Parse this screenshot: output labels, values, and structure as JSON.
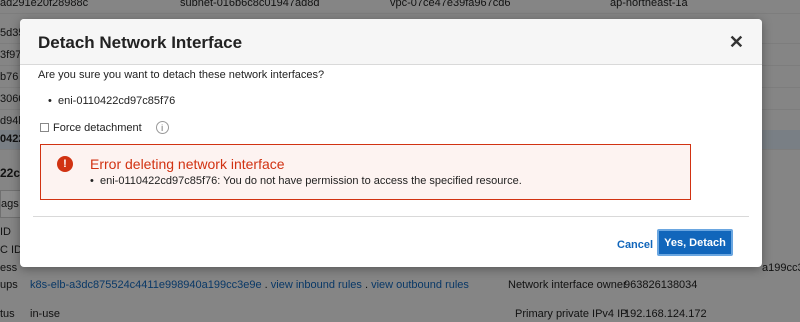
{
  "background": {
    "top_row": {
      "col1": "ad291e20f28988c",
      "col2": "subnet-016b6c8c01947ad8d",
      "col3": "vpc-07ce47e39fa967cd6",
      "col4": "ap-northeast-1a"
    },
    "left_fragments": [
      "5d35",
      "3f97",
      "b76",
      "3060",
      "d94b",
      "0422",
      "22c"
    ],
    "tab_label": "ags",
    "left_labels": [
      "ID",
      "C ID",
      "ess",
      "ups",
      "tus"
    ],
    "security_groups": {
      "group": "k8s-elb-a3dc875524c4411e998940a199cc3e9e",
      "inbound": "view inbound rules",
      "outbound": "view outbound rules"
    },
    "status_value": "in-use",
    "owner_label": "Network interface owner",
    "owner_value": "963826138034",
    "private_ip_label": "Primary private IPv4 IP",
    "private_ip_value": "192.168.124.172",
    "right_fragment": "a199cc3e"
  },
  "modal": {
    "title": "Detach Network Interface",
    "close_symbol": "✕",
    "question": "Are you sure you want to detach these network interfaces?",
    "eni": "eni-0110422cd97c85f76",
    "force_label": "Force detachment",
    "info_symbol": "i",
    "error": {
      "icon_symbol": "!",
      "title": "Error deleting network interface",
      "message": "eni-0110422cd97c85f76: You do not have permission to access the specified resource."
    },
    "cancel_label": "Cancel",
    "confirm_label": "Yes, Detach"
  },
  "colors": {
    "error": "#d13212",
    "link": "#1166bb",
    "primary": "#1166bb"
  }
}
